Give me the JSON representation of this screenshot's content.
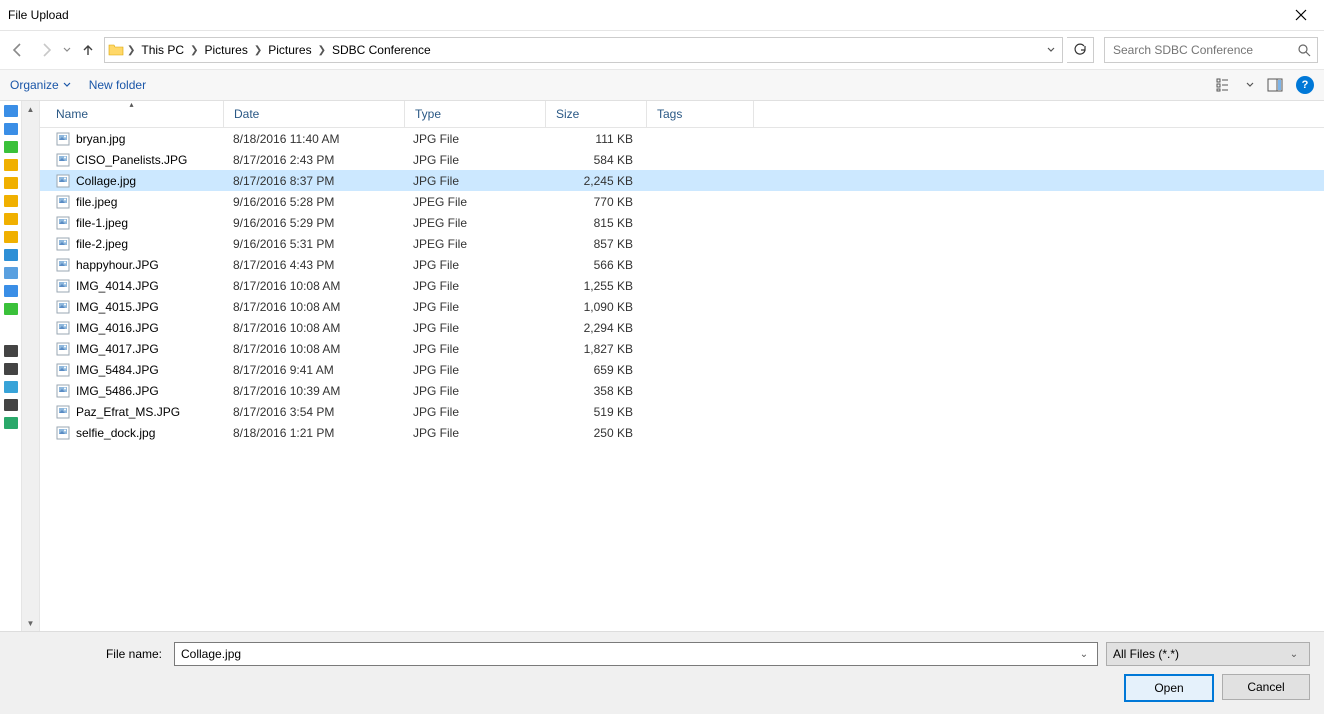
{
  "title": "File Upload",
  "breadcrumb": [
    "This PC",
    "Pictures",
    "Pictures",
    "SDBC Conference"
  ],
  "search_placeholder": "Search SDBC Conference",
  "toolbar": {
    "organize": "Organize",
    "new_folder": "New folder"
  },
  "columns": {
    "name": "Name",
    "date": "Date",
    "type": "Type",
    "size": "Size",
    "tags": "Tags"
  },
  "files": [
    {
      "name": "bryan.jpg",
      "date": "8/18/2016 11:40 AM",
      "type": "JPG File",
      "size": "111 KB"
    },
    {
      "name": "CISO_Panelists.JPG",
      "date": "8/17/2016 2:43 PM",
      "type": "JPG File",
      "size": "584 KB"
    },
    {
      "name": "Collage.jpg",
      "date": "8/17/2016 8:37 PM",
      "type": "JPG File",
      "size": "2,245 KB",
      "selected": true
    },
    {
      "name": "file.jpeg",
      "date": "9/16/2016 5:28 PM",
      "type": "JPEG File",
      "size": "770 KB"
    },
    {
      "name": "file-1.jpeg",
      "date": "9/16/2016 5:29 PM",
      "type": "JPEG File",
      "size": "815 KB"
    },
    {
      "name": "file-2.jpeg",
      "date": "9/16/2016 5:31 PM",
      "type": "JPEG File",
      "size": "857 KB"
    },
    {
      "name": "happyhour.JPG",
      "date": "8/17/2016 4:43 PM",
      "type": "JPG File",
      "size": "566 KB"
    },
    {
      "name": "IMG_4014.JPG",
      "date": "8/17/2016 10:08 AM",
      "type": "JPG File",
      "size": "1,255 KB"
    },
    {
      "name": "IMG_4015.JPG",
      "date": "8/17/2016 10:08 AM",
      "type": "JPG File",
      "size": "1,090 KB"
    },
    {
      "name": "IMG_4016.JPG",
      "date": "8/17/2016 10:08 AM",
      "type": "JPG File",
      "size": "2,294 KB"
    },
    {
      "name": "IMG_4017.JPG",
      "date": "8/17/2016 10:08 AM",
      "type": "JPG File",
      "size": "1,827 KB"
    },
    {
      "name": "IMG_5484.JPG",
      "date": "8/17/2016 9:41 AM",
      "type": "JPG File",
      "size": "659 KB"
    },
    {
      "name": "IMG_5486.JPG",
      "date": "8/17/2016 10:39 AM",
      "type": "JPG File",
      "size": "358 KB"
    },
    {
      "name": "Paz_Efrat_MS.JPG",
      "date": "8/17/2016 3:54 PM",
      "type": "JPG File",
      "size": "519 KB"
    },
    {
      "name": "selfie_dock.jpg",
      "date": "8/18/2016 1:21 PM",
      "type": "JPG File",
      "size": "250 KB"
    }
  ],
  "filename_label": "File name:",
  "filename_value": "Collage.jpg",
  "filter_value": "All Files (*.*)",
  "buttons": {
    "open": "Open",
    "cancel": "Cancel"
  },
  "nav_stubs": [
    "#3a8ee6",
    "#3a8ee6",
    "#3ac13a",
    "#f0b000",
    "#f0b000",
    "#f0b000",
    "#f0b000",
    "#f0b000",
    "#2d8fd6",
    "#5aa0e0",
    "#3a8ee6",
    "#3ac13a",
    "",
    "#444",
    "#444",
    "#38a3d8",
    "#444",
    "#2aa86a"
  ]
}
